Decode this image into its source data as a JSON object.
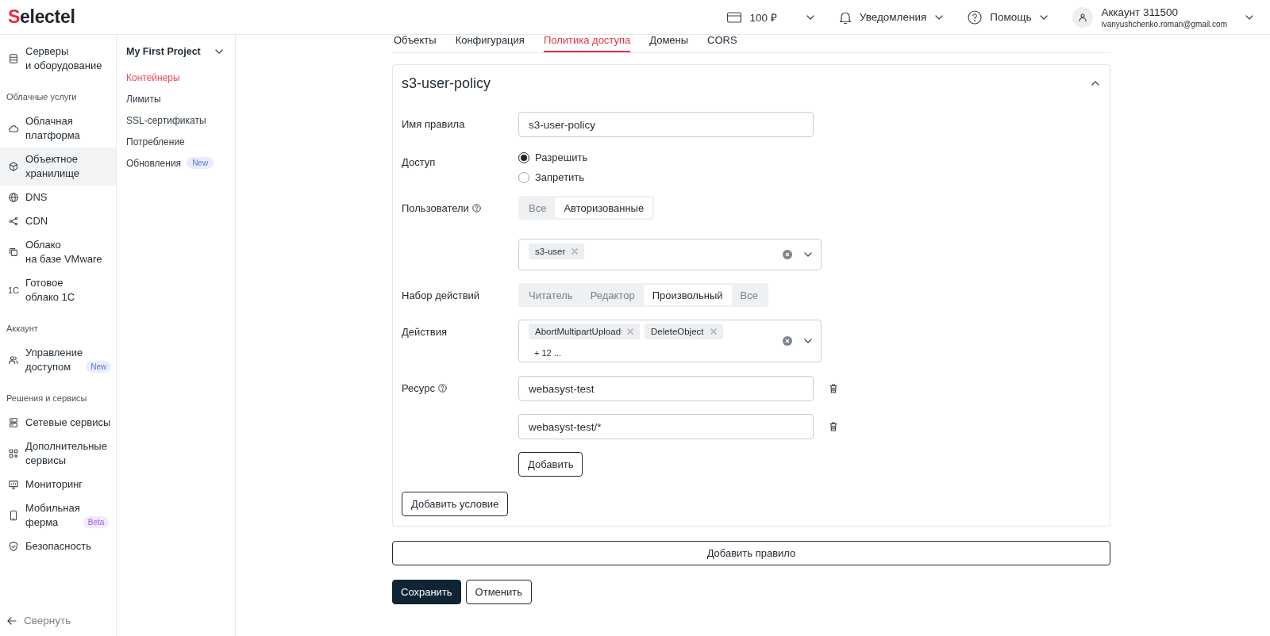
{
  "header": {
    "logo": "Selectel",
    "balance": "100 ₽",
    "notifications": "Уведомления",
    "help": "Помощь",
    "account_name": "Аккаунт 311500",
    "account_email": "ivanyushchenko.roman@gmail.com"
  },
  "sidebar": {
    "sections": [
      {
        "items": [
          {
            "label": "Серверы\nи оборудование",
            "selected": false
          }
        ]
      },
      {
        "heading": "Облачные услуги",
        "items": [
          {
            "label": "Облачная\nплатформа",
            "selected": false
          },
          {
            "label": "Объектное\nхранилище",
            "selected": true
          },
          {
            "label": "DNS",
            "selected": false
          },
          {
            "label": "CDN",
            "selected": false
          },
          {
            "label": "Облако\nна базе VMware",
            "selected": false
          },
          {
            "label": "Готовое\nоблако 1С",
            "selected": false,
            "icon_text": "1С"
          }
        ]
      },
      {
        "heading": "Аккаунт",
        "items": [
          {
            "label": "Управление\nдоступом",
            "selected": false,
            "badge": {
              "text": "New",
              "color": "#eaeefc"
            }
          }
        ]
      },
      {
        "heading": "Решения и сервисы",
        "items": [
          {
            "label": "Сетевые сервисы",
            "selected": false
          },
          {
            "label": "Дополнительные\nсервисы",
            "selected": false
          },
          {
            "label": "Мониторинг",
            "selected": false
          },
          {
            "label": "Мобильная\nферма",
            "selected": false,
            "badge": {
              "text": "Beta",
              "color": "#f3eafd"
            }
          },
          {
            "label": "Безопасность",
            "selected": false
          }
        ]
      }
    ],
    "collapse": "Свернуть"
  },
  "project": {
    "title": "My First Project",
    "items": [
      {
        "label": "Контейнеры",
        "selected": true
      },
      {
        "label": "Лимиты",
        "selected": false
      },
      {
        "label": "SSL-сертификаты",
        "selected": false
      },
      {
        "label": "Потребление",
        "selected": false
      },
      {
        "label": "Обновления",
        "selected": false,
        "badge": {
          "text": "New",
          "color": "#eaeefc"
        }
      }
    ]
  },
  "tabs": [
    {
      "label": "Объекты",
      "selected": false
    },
    {
      "label": "Конфигурация",
      "selected": false
    },
    {
      "label": "Политика доступа",
      "selected": true
    },
    {
      "label": "Домены",
      "selected": false
    },
    {
      "label": "CORS",
      "selected": false
    }
  ],
  "policy": {
    "title": "s3-user-policy",
    "expanded": true,
    "name_label": "Имя правила",
    "name_value": "s3-user-policy",
    "access_label": "Доступ",
    "access_options": [
      {
        "label": "Разрешить",
        "selected": true
      },
      {
        "label": "Запретить",
        "selected": false
      }
    ],
    "users_label": "Пользователи",
    "users_options": [
      {
        "label": "Все",
        "selected": false
      },
      {
        "label": "Авторизованные",
        "selected": true
      }
    ],
    "users_tags": [
      "s3-user"
    ],
    "action_set_label": "Набор действий",
    "action_set_options": [
      {
        "label": "Читатель",
        "selected": false
      },
      {
        "label": "Редактор",
        "selected": false
      },
      {
        "label": "Произвольный",
        "selected": true
      },
      {
        "label": "Все",
        "selected": false
      }
    ],
    "actions_label": "Действия",
    "actions_tags": [
      "AbortMultipartUpload",
      "DeleteObject"
    ],
    "actions_more": "+ 12 ...",
    "resource_label": "Ресурс",
    "resources": [
      "webasyst-test",
      "webasyst-test/*"
    ],
    "add_resource": "Добавить",
    "add_condition": "Добавить условие"
  },
  "add_rule": "Добавить правило",
  "save": "Сохранить",
  "cancel": "Отменить"
}
